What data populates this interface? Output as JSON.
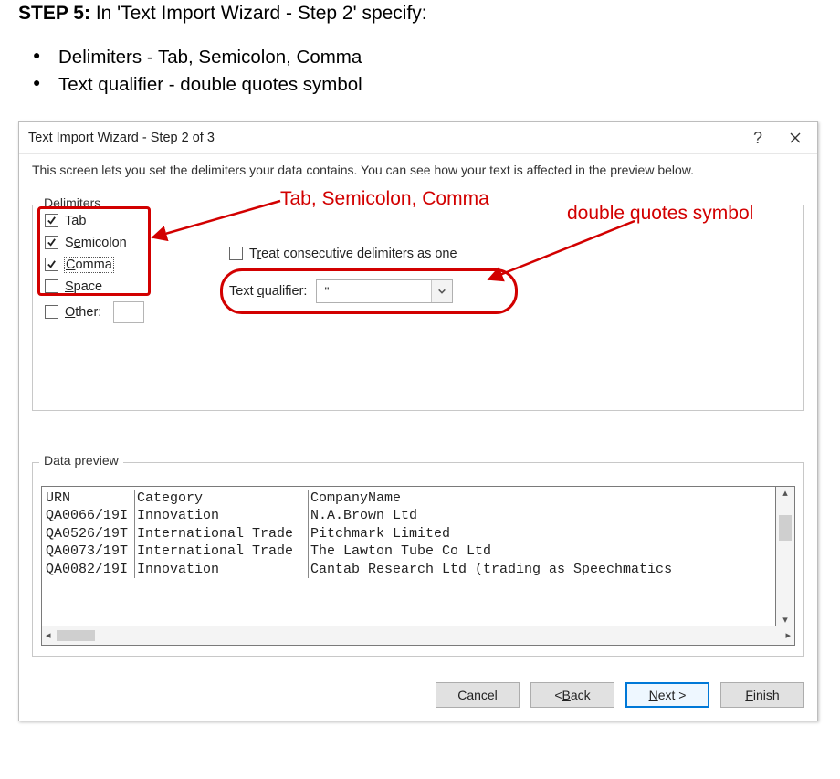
{
  "doc": {
    "step_label": "STEP 5:",
    "step_text": " In 'Text Import Wizard - Step 2' specify:",
    "bullets": [
      "Delimiters - Tab, Semicolon, Comma",
      "Text qualifier - double quotes symbol"
    ]
  },
  "dialog": {
    "title": "Text Import Wizard - Step 2 of 3",
    "help": "?",
    "instruction": "This screen lets you set the delimiters your data contains.  You can see how your text is affected in the preview below.",
    "delimiters": {
      "legend": "Delimiters",
      "tab": "Tab",
      "semicolon": "Semicolon",
      "comma": "Comma",
      "space": "Space",
      "other": "Other:",
      "consecutive": "Treat consecutive delimiters as one",
      "qualifier_label": "Text qualifier:",
      "qualifier_value": "\""
    },
    "preview": {
      "legend": "Data preview",
      "cols": [
        "URN",
        "Category",
        "CompanyName"
      ],
      "rows": [
        [
          "QA0066/19I",
          "Innovation",
          "N.A.Brown Ltd"
        ],
        [
          "QA0526/19T",
          "International Trade",
          "Pitchmark Limited"
        ],
        [
          "QA0073/19T",
          "International Trade",
          "The Lawton Tube Co Ltd"
        ],
        [
          "QA0082/19I",
          "Innovation",
          "Cantab Research Ltd (trading as Speechmatics"
        ]
      ]
    },
    "buttons": {
      "cancel": "Cancel",
      "back": "< Back",
      "next": "Next >",
      "finish": "Finish"
    }
  },
  "annotations": {
    "delim_label": "Tab, Semicolon, Comma",
    "qualifier_label": "double quotes symbol"
  }
}
